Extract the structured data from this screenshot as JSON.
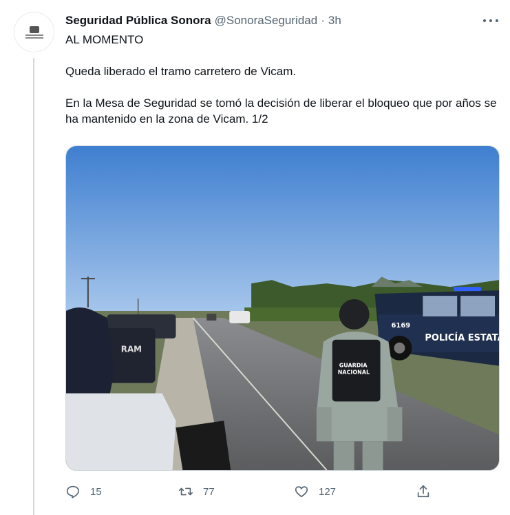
{
  "tweet": {
    "author_name": "Seguridad Pública Sonora",
    "handle": "@SonoraSeguridad",
    "separator": "·",
    "time": "3h",
    "lines": [
      "AL MOMENTO",
      "Queda liberado el tramo carretero de Vicam.",
      "En la Mesa de Seguridad se tomó la decisión de liberar el bloqueo que por años se ha mantenido en la zona de Vicam. 1/2"
    ],
    "avatar_icon": "government-seal-icon",
    "photo": {
      "truck_label": "POLICÍA ESTATAL",
      "truck_number": "6169",
      "vest_label_1": "GUARDIA",
      "vest_label_2": "NACIONAL",
      "left_truck_label": "RAM"
    }
  },
  "actions": {
    "reply": {
      "icon": "reply-icon",
      "count": "15"
    },
    "retweet": {
      "icon": "retweet-icon",
      "count": "77"
    },
    "like": {
      "icon": "heart-icon",
      "count": "127"
    },
    "share": {
      "icon": "share-icon"
    }
  },
  "colors": {
    "text_primary": "#0f1419",
    "text_secondary": "#536471",
    "border": "#cfd9de"
  }
}
